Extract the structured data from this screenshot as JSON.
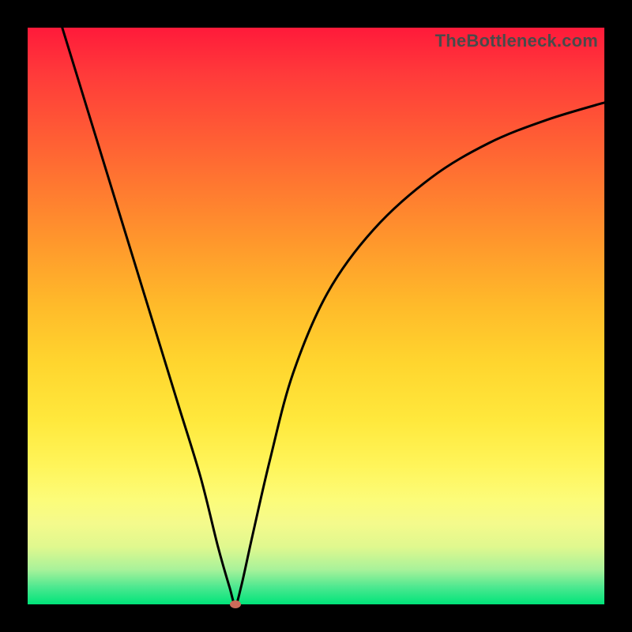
{
  "watermark": "TheBottleneck.com",
  "colors": {
    "frame": "#000000",
    "curve": "#000000",
    "marker": "#cc6b5a"
  },
  "chart_data": {
    "type": "line",
    "title": "",
    "xlabel": "",
    "ylabel": "",
    "xlim": [
      0,
      100
    ],
    "ylim": [
      0,
      100
    ],
    "grid": false,
    "legend": false,
    "note": "Values are read off the curve in plot-area percent coordinates (x: 0–100 left→right, y: 0–100 bottom→top). The vertical gradient maps y≈100 to red and y≈0 to green; the curve reaches its minimum (best/green) near x≈36.",
    "series": [
      {
        "name": "bottleneck-curve",
        "x": [
          6,
          10,
          14,
          18,
          22,
          26,
          30,
          33,
          35,
          36,
          37,
          39,
          42,
          46,
          52,
          60,
          70,
          80,
          90,
          100
        ],
        "y": [
          100,
          87,
          74,
          61,
          48,
          35,
          22,
          10,
          3,
          0,
          3,
          12,
          25,
          40,
          54,
          65,
          74,
          80,
          84,
          87
        ]
      }
    ],
    "marker": {
      "x": 36,
      "y": 0
    }
  }
}
